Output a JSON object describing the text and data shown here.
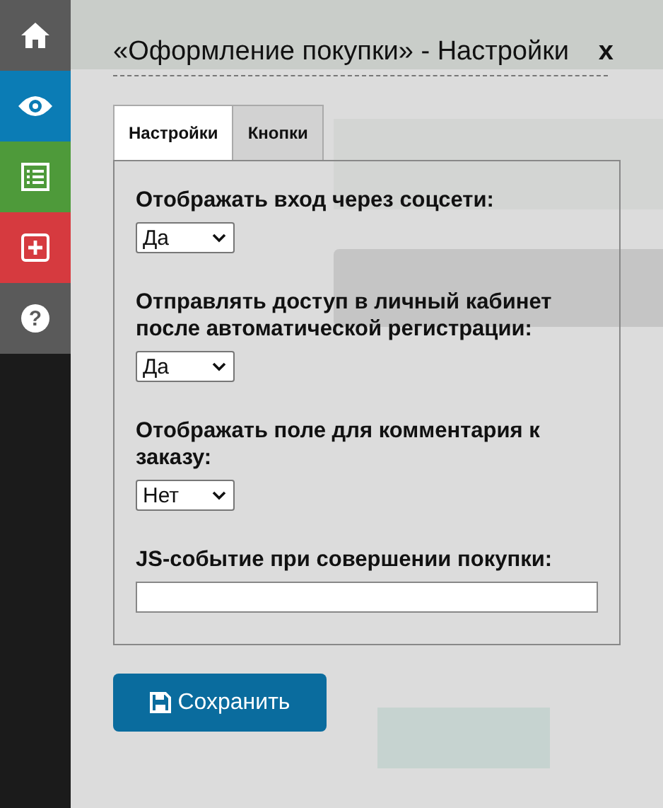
{
  "sidebar": {
    "items": [
      {
        "kind": "home",
        "color": "#5a5a5a"
      },
      {
        "kind": "eye",
        "color": "#0b7cb5"
      },
      {
        "kind": "list",
        "color": "#4e9a3a"
      },
      {
        "kind": "plus",
        "color": "#d63a3f"
      },
      {
        "kind": "help",
        "color": "#5a5a5a",
        "glyph": "?"
      }
    ]
  },
  "dialog": {
    "title": "«Оформление покупки» - Настройки",
    "close": "x",
    "tabs": [
      {
        "label": "Настройки",
        "selected": true
      },
      {
        "label": "Кнопки",
        "selected": false
      }
    ],
    "fields": [
      {
        "kind": "select",
        "label": "Отображать вход через соцсети:",
        "value": "Да"
      },
      {
        "kind": "select",
        "label": "Отправлять доступ в личный кабинет после автоматической регистрации:",
        "value": "Да"
      },
      {
        "kind": "select",
        "label": "Отображать поле для комментария к заказу:",
        "value": "Нет"
      },
      {
        "kind": "text",
        "label": "JS-событие при совершении покупки:"
      }
    ],
    "save_button": "Сохранить"
  }
}
